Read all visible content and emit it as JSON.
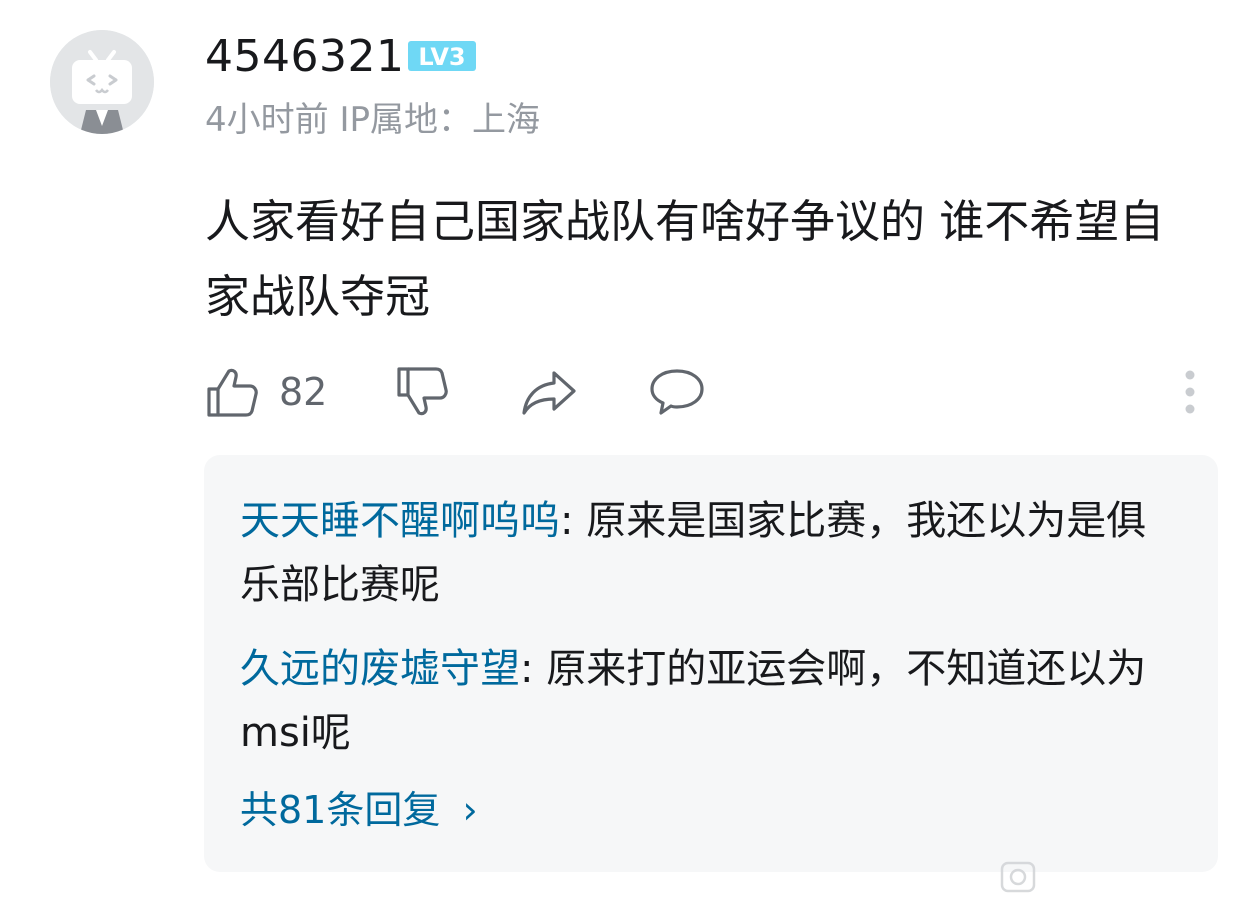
{
  "comment": {
    "author": {
      "username": "4546321",
      "level_badge": "LV3",
      "avatar_icon": "tv-mascot-icon"
    },
    "time_location": "4小时前 IP属地：上海",
    "text": "人家看好自己国家战队有啥好争议的 谁不希望自家战队夺冠",
    "actions": {
      "like_icon": "thumbs-up-icon",
      "like_count": "82",
      "dislike_icon": "thumbs-down-icon",
      "share_icon": "share-icon",
      "reply_icon": "comment-icon",
      "more_icon": "more-vertical-icon"
    }
  },
  "replies": [
    {
      "user": "天天睡不醒啊呜呜",
      "separator": ": ",
      "text": "原来是国家比赛，我还以为是俱乐部比赛呢"
    },
    {
      "user": "久远的废墟守望",
      "separator": ": ",
      "text": "原来打的亚运会啊，不知道还以为msi呢"
    }
  ],
  "reply_count_label": "共81条回复",
  "reply_count_chevron": "›",
  "watermark": "",
  "colors": {
    "text": "#18191c",
    "meta": "#9499a0",
    "link": "#00699d",
    "level_badge": "#6fd8f5",
    "replies_bg": "#f6f7f8"
  }
}
